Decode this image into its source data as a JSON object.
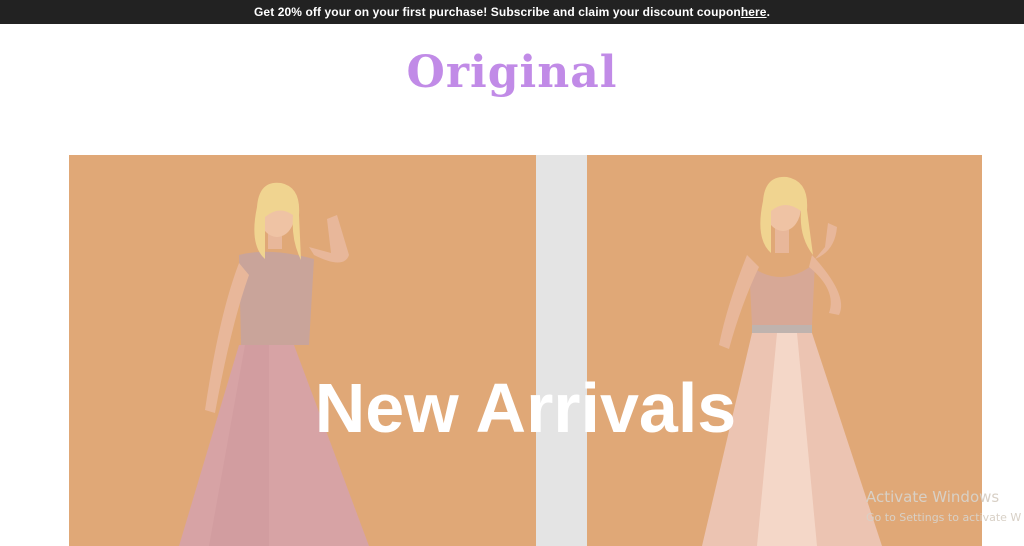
{
  "announcement": {
    "text": "Get 20% off your on your first purchase! Subscribe and claim your discount coupon",
    "link_label": " here",
    "suffix": "."
  },
  "brand": {
    "logo_text": "Original",
    "color": "#c18be7"
  },
  "hero": {
    "title": "New Arrivals",
    "background_color": "#e0a877",
    "divider_color": "#e4e4e4",
    "images": [
      {
        "alt": "Model in blush pink beaded tulle gown"
      },
      {
        "alt": "Model in champagne satin gown with beaded bodice"
      }
    ]
  },
  "watermark": {
    "line1": "Activate Windows",
    "line2": "Go to Settings to activate W"
  }
}
